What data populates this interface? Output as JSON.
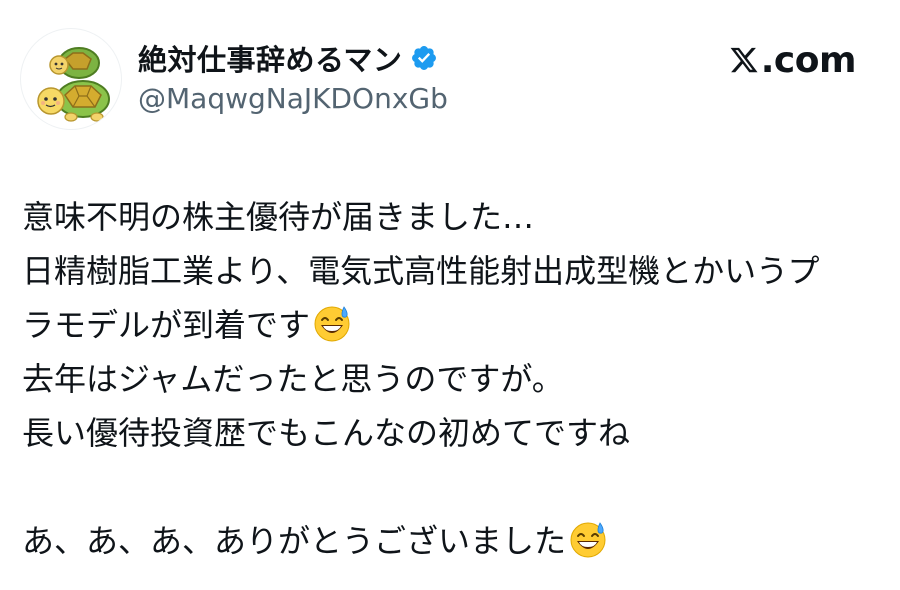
{
  "header": {
    "display_name": "絶対仕事辞めるマン",
    "handle": "@MaqwgNaJKDOnxGb",
    "verified_icon": "verified-badge-icon",
    "site": "X.com",
    "site_text": ".com",
    "accent_color": "#1d9bf0"
  },
  "tweet": {
    "line1": "意味不明の株主優待が届きました…",
    "line2": "日精樹脂工業より、電気式高性能射出成型機とかいうプ",
    "line3": "ラモデルが到着です",
    "line4": "去年はジャムだったと思うのですが。",
    "line5": "長い優待投資歴でもこんなの初めてですね",
    "line6": "あ、あ、あ、ありがとうございました",
    "emoji": "grinning-face-with-sweat-emoji"
  }
}
